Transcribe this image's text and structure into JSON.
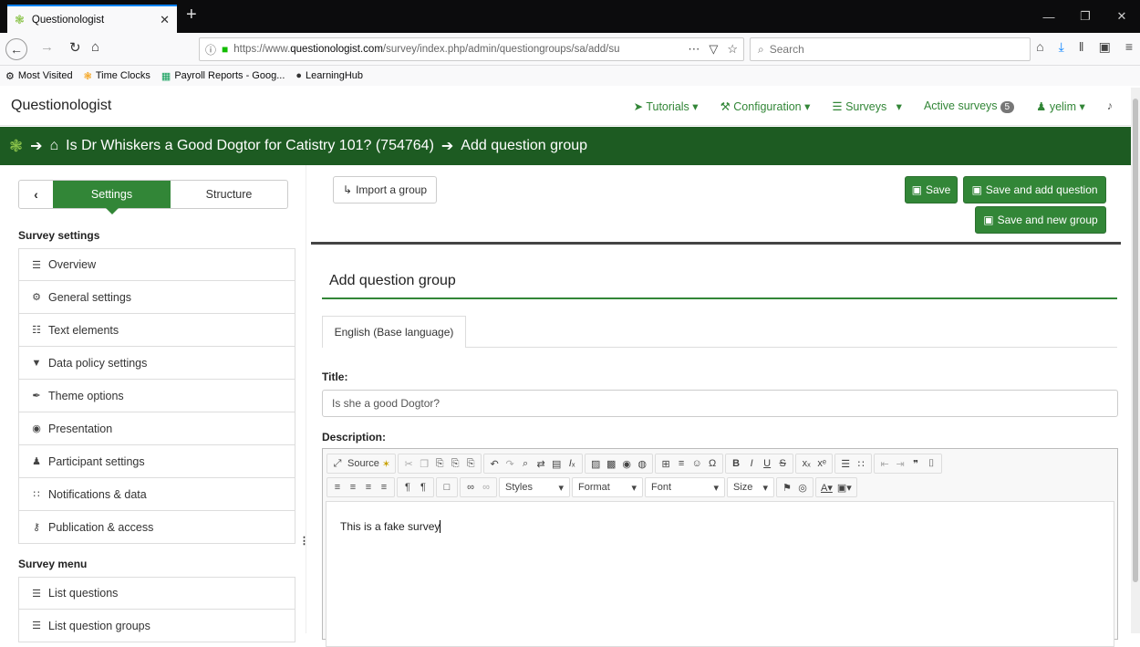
{
  "browser": {
    "tab_title": "Questionologist",
    "url_prefix": "https://www.",
    "url_domain": "questionologist.com",
    "url_path": "/survey/index.php/admin/questiongroups/sa/add/su",
    "search_placeholder": "Search",
    "bookmarks": [
      {
        "label": "Most Visited",
        "icon": "gear-icon"
      },
      {
        "label": "Time Clocks",
        "icon": "logo-icon"
      },
      {
        "label": "Payroll Reports - Goog...",
        "icon": "sheet-icon"
      },
      {
        "label": "LearningHub",
        "icon": "circle-icon"
      }
    ]
  },
  "app": {
    "brand": "Questionologist",
    "nav": {
      "tutorials": "Tutorials",
      "configuration": "Configuration",
      "surveys": "Surveys",
      "active_surveys": "Active surveys",
      "active_count": "5",
      "user": "yelim"
    },
    "breadcrumb": {
      "survey": "Is Dr Whiskers a Good Dogtor for Catistry 101? (754764)",
      "page": "Add question group"
    },
    "accent_color": "#328637",
    "header_color": "#1d5b22"
  },
  "sidebar": {
    "settings_label": "Settings",
    "structure_label": "Structure",
    "survey_settings_heading": "Survey settings",
    "settings_items": [
      {
        "label": "Overview",
        "icon": "list-icon"
      },
      {
        "label": "General settings",
        "icon": "cogs-icon"
      },
      {
        "label": "Text elements",
        "icon": "file-text-icon"
      },
      {
        "label": "Data policy settings",
        "icon": "shield-icon"
      },
      {
        "label": "Theme options",
        "icon": "brush-icon"
      },
      {
        "label": "Presentation",
        "icon": "eye-slash-icon"
      },
      {
        "label": "Participant settings",
        "icon": "users-icon"
      },
      {
        "label": "Notifications & data",
        "icon": "rss-icon"
      },
      {
        "label": "Publication & access",
        "icon": "key-icon"
      }
    ],
    "survey_menu_heading": "Survey menu",
    "menu_items": [
      {
        "label": "List questions",
        "icon": "list-icon"
      },
      {
        "label": "List question groups",
        "icon": "list-icon"
      }
    ]
  },
  "main": {
    "import_label": "Import a group",
    "save_label": "Save",
    "save_add_question_label": "Save and add question",
    "save_new_group_label": "Save and new group",
    "form_title": "Add question group",
    "language_tab": "English (Base language)",
    "title_label": "Title:",
    "title_value": "Is she a good Dogtor?",
    "description_label": "Description:",
    "description_value": "This is a fake survey",
    "editor": {
      "source_label": "Source",
      "styles_label": "Styles",
      "format_label": "Format",
      "font_label": "Font",
      "size_label": "Size"
    }
  }
}
